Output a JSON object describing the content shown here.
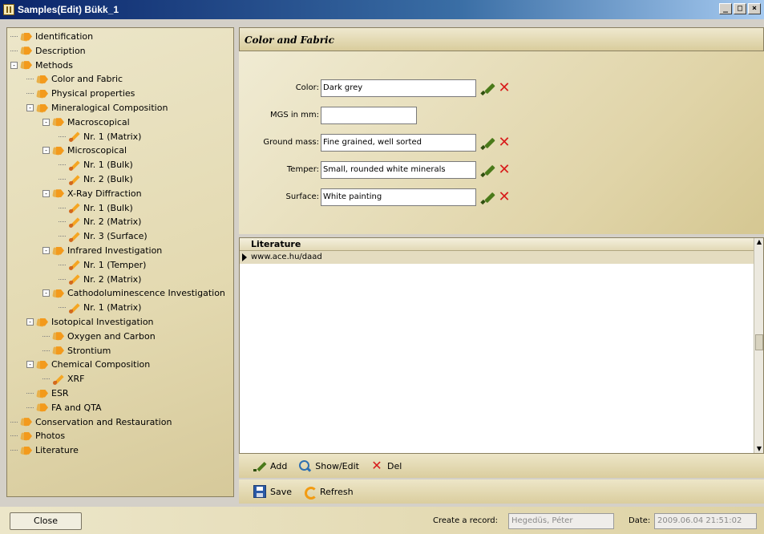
{
  "window": {
    "title": "Samples(Edit) Bükk_1",
    "minimize": "_",
    "maximize": "□",
    "close": "×"
  },
  "tree": [
    {
      "label": "Identification",
      "level": 1,
      "icon": "folder-icon",
      "expander": ""
    },
    {
      "label": "Description",
      "level": 1,
      "icon": "folder-icon",
      "expander": ""
    },
    {
      "label": "Methods",
      "level": 1,
      "icon": "folder-icon",
      "expander": "-"
    },
    {
      "label": "Color and Fabric",
      "level": 2,
      "icon": "folder-icon",
      "expander": ""
    },
    {
      "label": "Physical properties",
      "level": 2,
      "icon": "folder-icon",
      "expander": ""
    },
    {
      "label": "Mineralogical Composition",
      "level": 2,
      "icon": "folder-icon",
      "expander": "-"
    },
    {
      "label": "Macroscopical",
      "level": 3,
      "icon": "folder-icon",
      "expander": "-"
    },
    {
      "label": "Nr. 1 (Matrix)",
      "level": 4,
      "icon": "pencil-icon",
      "expander": ""
    },
    {
      "label": "Microscopical",
      "level": 3,
      "icon": "folder-icon",
      "expander": "-"
    },
    {
      "label": "Nr. 1 (Bulk)",
      "level": 4,
      "icon": "pencil-icon",
      "expander": ""
    },
    {
      "label": "Nr. 2 (Bulk)",
      "level": 4,
      "icon": "pencil-icon",
      "expander": ""
    },
    {
      "label": "X-Ray Diffraction",
      "level": 3,
      "icon": "folder-icon",
      "expander": "-"
    },
    {
      "label": "Nr. 1 (Bulk)",
      "level": 4,
      "icon": "pencil-icon",
      "expander": ""
    },
    {
      "label": "Nr. 2 (Matrix)",
      "level": 4,
      "icon": "pencil-icon",
      "expander": ""
    },
    {
      "label": "Nr. 3 (Surface)",
      "level": 4,
      "icon": "pencil-icon",
      "expander": ""
    },
    {
      "label": "Infrared Investigation",
      "level": 3,
      "icon": "folder-icon",
      "expander": "-"
    },
    {
      "label": "Nr. 1 (Temper)",
      "level": 4,
      "icon": "pencil-icon",
      "expander": ""
    },
    {
      "label": "Nr. 2 (Matrix)",
      "level": 4,
      "icon": "pencil-icon",
      "expander": ""
    },
    {
      "label": "Cathodoluminescence Investigation",
      "level": 3,
      "icon": "folder-icon",
      "expander": "-"
    },
    {
      "label": "Nr. 1 (Matrix)",
      "level": 4,
      "icon": "pencil-icon",
      "expander": ""
    },
    {
      "label": "Isotopical Investigation",
      "level": 2,
      "icon": "folder-icon",
      "expander": "-"
    },
    {
      "label": "Oxygen and Carbon",
      "level": 3,
      "icon": "folder-icon",
      "expander": ""
    },
    {
      "label": "Strontium",
      "level": 3,
      "icon": "folder-icon",
      "expander": ""
    },
    {
      "label": "Chemical Composition",
      "level": 2,
      "icon": "folder-icon",
      "expander": "-"
    },
    {
      "label": "XRF",
      "level": 3,
      "icon": "pencil-icon",
      "expander": ""
    },
    {
      "label": "ESR",
      "level": 2,
      "icon": "folder-icon",
      "expander": ""
    },
    {
      "label": "FA and QTA",
      "level": 2,
      "icon": "folder-icon",
      "expander": ""
    },
    {
      "label": "Conservation and Restauration",
      "level": 1,
      "icon": "folder-icon",
      "expander": ""
    },
    {
      "label": "Photos",
      "level": 1,
      "icon": "folder-icon",
      "expander": ""
    },
    {
      "label": "Literature",
      "level": 1,
      "icon": "folder-icon",
      "expander": ""
    }
  ],
  "section": {
    "title": "Color and Fabric"
  },
  "form": {
    "color": {
      "label": "Color:",
      "value": "Dark grey"
    },
    "mgs": {
      "label": "MGS in mm:",
      "value": ""
    },
    "ground_mass": {
      "label": "Ground mass:",
      "value": "Fine grained, well sorted"
    },
    "temper": {
      "label": "Temper:",
      "value": "Small, rounded white minerals"
    },
    "surface": {
      "label": "Surface:",
      "value": "White painting"
    }
  },
  "grid": {
    "header": "Literature",
    "rows": [
      "www.ace.hu/daad"
    ]
  },
  "toolbar": {
    "add": "Add",
    "show_edit": "Show/Edit",
    "del": "Del",
    "save": "Save",
    "refresh": "Refresh"
  },
  "status": {
    "close": "Close",
    "create_label": "Create a record:",
    "create_value": "Hegedüs, Péter",
    "date_label": "Date:",
    "date_value": "2009.06.04 21:51:02"
  }
}
